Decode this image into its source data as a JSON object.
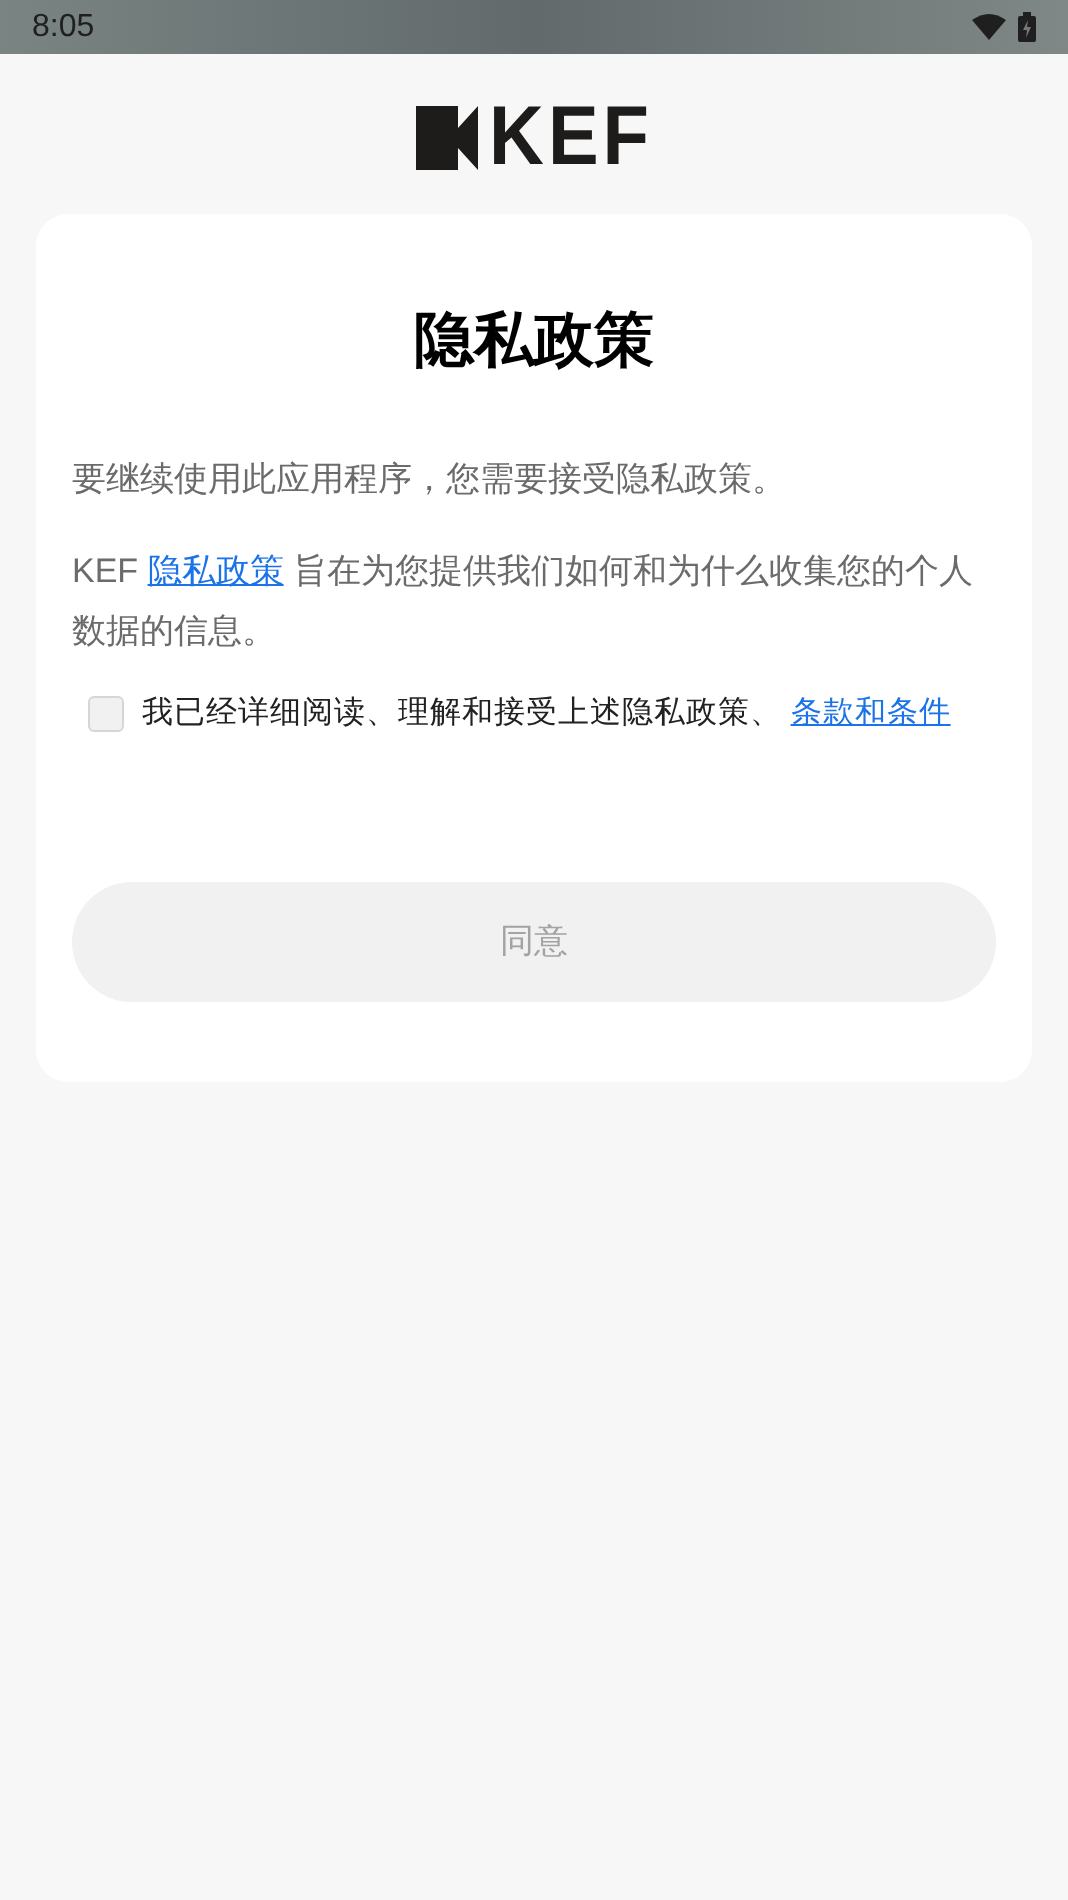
{
  "status_bar": {
    "time": "8:05"
  },
  "logo": {
    "text": "KEF"
  },
  "dialog": {
    "title": "隐私政策",
    "intro": "要继续使用此应用程序，您需要接受隐私政策。",
    "policy_text": {
      "before": "KEF ",
      "link": "隐私政策",
      "after": " 旨在为您提供我们如何和为什么收集您的个人数据的信息。"
    },
    "consent": {
      "checked": false,
      "label": "我已经详细阅读、理解和接受上述隐私政策、",
      "link": "条款和条件"
    },
    "agree_button": {
      "label": "同意",
      "disabled": true
    }
  }
}
